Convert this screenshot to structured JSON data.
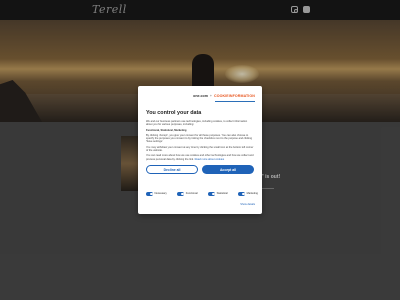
{
  "header": {
    "logo_text": "Terell",
    "icons": [
      "instagram-icon",
      "youtube-icon"
    ]
  },
  "hero": {
    "description": "sunset beach photo with silhouette"
  },
  "content": {
    "quote_fragment": "ide at all,\" is out!"
  },
  "consent": {
    "brand_one": "one.com",
    "brand_plus": "+",
    "brand_ci": "COOKIEINFORMATION",
    "title": "You control your data",
    "p1": "We and our business partners use technologies, including cookies, to collect information about you for various purposes, including:",
    "subtitle": "Functional, Statistical, Marketing",
    "p2": "By clicking 'Accept', you give your consent for all these purposes. You can also choose to specify the purposes you consent to by ticking the checkbox next to the purpose and clicking 'Save settings'.",
    "p3": "You may withdraw your consent at any time by clicking the small icon at the bottom left corner of the website.",
    "p4": "You can read more about how we use cookies and other technologies and how we collect and process personal data by clicking the link.",
    "link": "Read more about cookies",
    "decline_label": "Decline all",
    "accept_label": "Accept all",
    "toggles": [
      {
        "label": "Necessary",
        "on": true
      },
      {
        "label": "Functional",
        "on": true
      },
      {
        "label": "Statistical",
        "on": true
      },
      {
        "label": "Marketing",
        "on": true
      }
    ],
    "footer_link": "Show details"
  },
  "colors": {
    "accent": "#1f63b8",
    "brand_orange": "#e8541c",
    "topbar": "#1a1a1a"
  }
}
